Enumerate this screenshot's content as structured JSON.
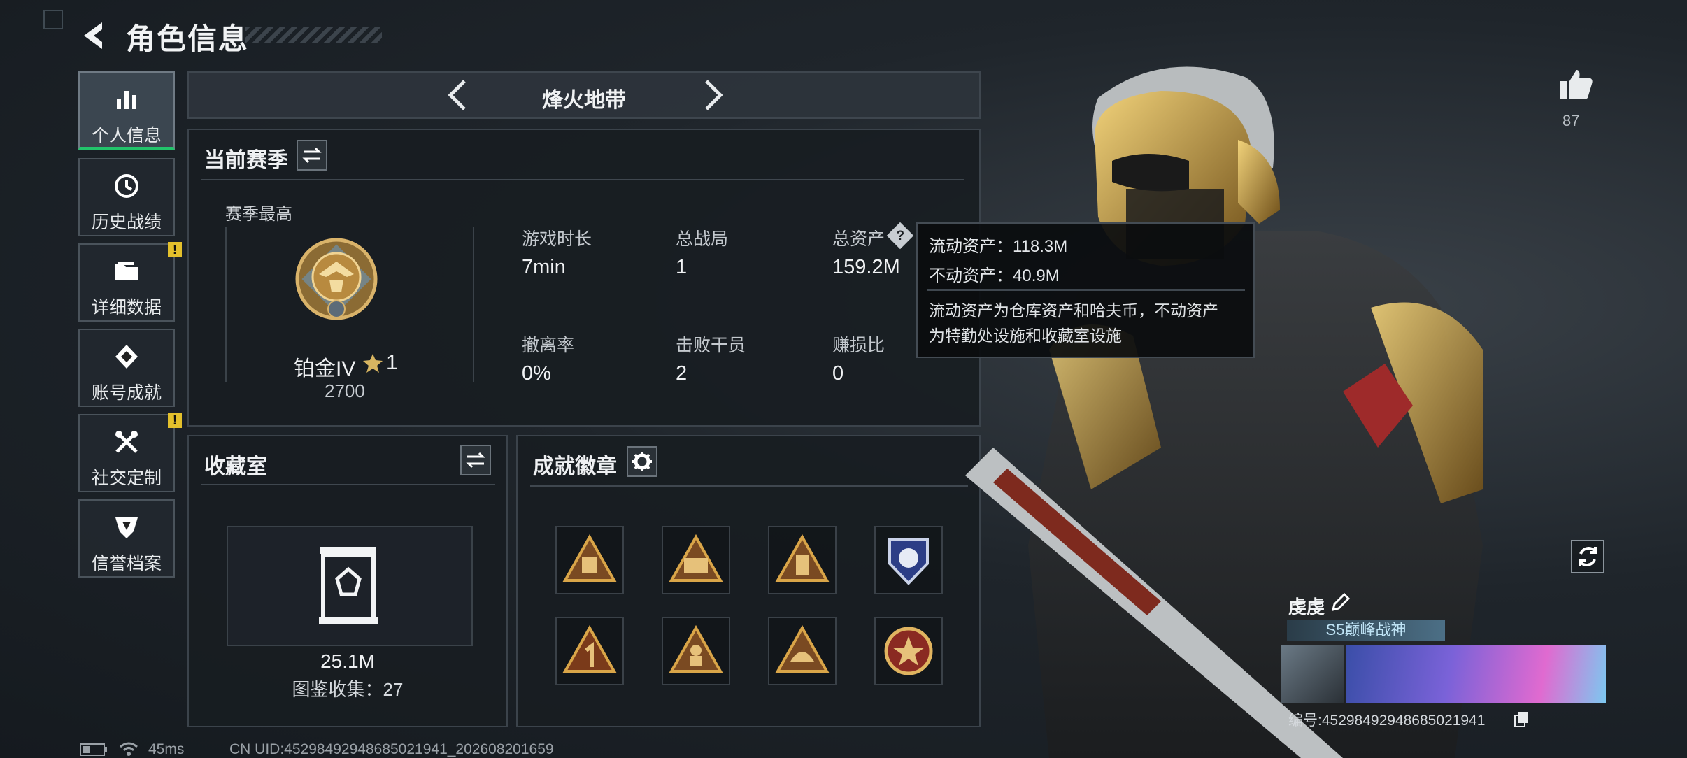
{
  "header": {
    "title": "角色信息"
  },
  "nav": {
    "items": [
      {
        "label": "个人信息",
        "icon": "bar-chart-icon",
        "active": true,
        "warning": false
      },
      {
        "label": "历史战绩",
        "icon": "history-clock-icon",
        "active": false,
        "warning": false
      },
      {
        "label": "详细数据",
        "icon": "folder-icon",
        "active": false,
        "warning": true
      },
      {
        "label": "账号成就",
        "icon": "achievement-icon",
        "active": false,
        "warning": false
      },
      {
        "label": "社交定制",
        "icon": "tools-icon",
        "active": false,
        "warning": true
      },
      {
        "label": "信誉档案",
        "icon": "shield-badge-icon",
        "active": false,
        "warning": false
      }
    ],
    "warning_mark": "!"
  },
  "mode": {
    "label": "烽火地带"
  },
  "season": {
    "title": "当前赛季",
    "best_label": "赛季最高",
    "rank_name": "铂金IV",
    "rank_stars": "1",
    "rank_points": "2700",
    "stats": [
      {
        "label": "游戏时长",
        "value": "7min"
      },
      {
        "label": "总战局",
        "value": "1"
      },
      {
        "label": "总资产",
        "value": "159.2M"
      },
      {
        "label": "撤离率",
        "value": "0%"
      },
      {
        "label": "击败干员",
        "value": "2"
      },
      {
        "label": "赚损比",
        "value": "0"
      }
    ],
    "help_mark": "?"
  },
  "tooltip": {
    "liquid": "流动资产：118.3M",
    "fixed": "不动资产：40.9M",
    "note_line1": "流动资产为仓库资产和哈夫币，不动资产",
    "note_line2": "为特勤处设施和收藏室设施"
  },
  "collection": {
    "title": "收藏室",
    "value": "25.1M",
    "count_text": "图鉴收集：27"
  },
  "achievements": {
    "title": "成就徽章",
    "badges": [
      "bag-triangle-badge",
      "s5-triangle-badge",
      "lantern-triangle-badge",
      "shield-blue-badge",
      "number-one-triangle-badge",
      "soldier-triangle-badge",
      "helmet-triangle-badge",
      "star-circle-badge"
    ]
  },
  "likes": {
    "count": "87"
  },
  "player": {
    "name": "虔虔",
    "title": "S5巅峰战神",
    "id_text": "编号:4529849294868502194​1"
  },
  "status_bar": {
    "ping": "45ms",
    "uid": "CN UID:452984929486850219​41_202608201659"
  }
}
